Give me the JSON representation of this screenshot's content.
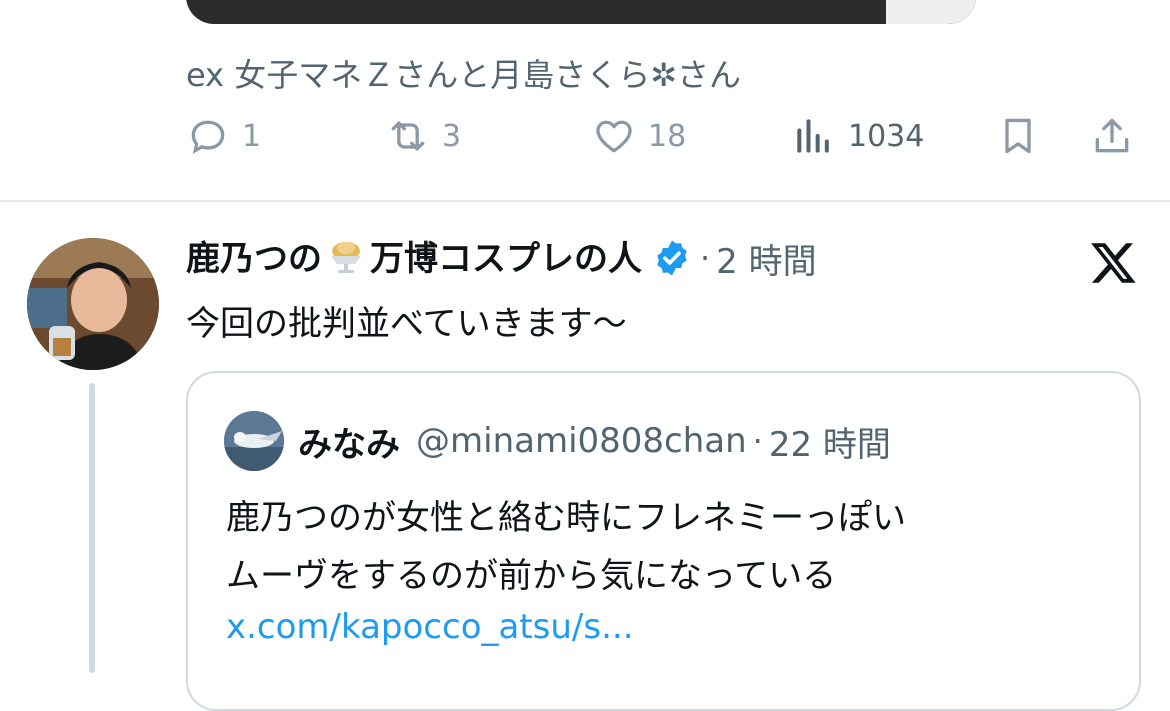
{
  "previous_tweet": {
    "tagged_text": "ex 女子マネＺさんと月島さくら✲さん",
    "actions": {
      "reply": {
        "icon": "reply-icon",
        "count": "1"
      },
      "retweet": {
        "icon": "retweet-icon",
        "count": "3"
      },
      "like": {
        "icon": "heart-icon",
        "count": "18"
      },
      "views": {
        "icon": "views-chart-icon",
        "count": "1034"
      },
      "bookmark": {
        "icon": "bookmark-icon"
      },
      "share": {
        "icon": "share-icon"
      }
    }
  },
  "tweet": {
    "display_name_part1": "鹿乃つの",
    "display_name_emoji": "ice-cream-sundae-emoji",
    "display_name_part2": "万博コスプレの人",
    "verified_icon": "verified-badge-icon",
    "separator": "·",
    "time": "2 時間",
    "brand_icon": "x-logo-icon",
    "text": "今回の批判並べていきます〜",
    "quote": {
      "name": "みなみ",
      "handle": "@minami0808chan",
      "separator": "·",
      "time": "22 時間",
      "text_line1": "鹿乃つのが女性と絡む時にフレネミーっぽい",
      "text_line2": "ムーヴをするのが前から気になっている",
      "link": "x.com/kapocco_atsu/s..."
    }
  },
  "colors": {
    "text_primary": "#0f1419",
    "text_secondary": "#536471",
    "icon_muted": "#8b98a5",
    "link": "#1d9bf0",
    "verified": "#1d9bf0",
    "border": "#cfd9de"
  }
}
